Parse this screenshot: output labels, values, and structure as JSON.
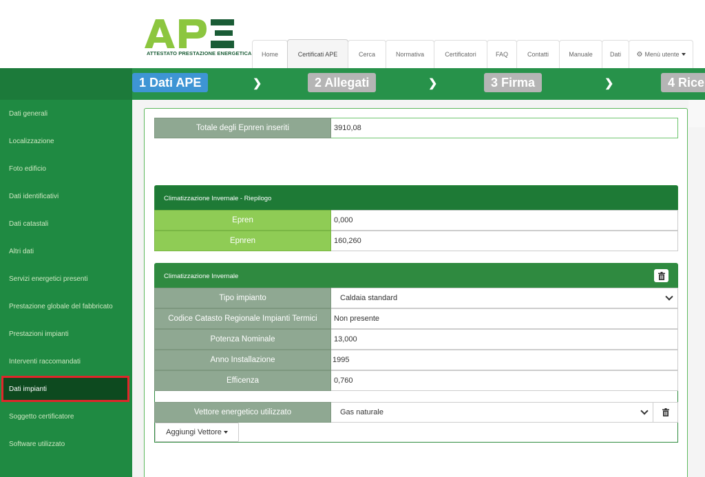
{
  "logo": {
    "name": "APE",
    "tagline": "ATTESTATO PRESTAZIONE ENERGETICA",
    "colors": {
      "green": "#8cc63f",
      "dark": "#1a5c36"
    }
  },
  "nav": {
    "tabs": [
      "Home",
      "Certificati APE",
      "Cerca",
      "Normativa",
      "Certificatori",
      "FAQ",
      "Contatti",
      "Manuale",
      "Dati",
      "Menù utente"
    ],
    "active_tab": "Certificati APE",
    "user_menu_icon": "gear-icon"
  },
  "steps": [
    {
      "label": "1 Dati APE",
      "active": true
    },
    {
      "label": "2 Allegati",
      "active": false
    },
    {
      "label": "3 Firma",
      "active": false
    },
    {
      "label": "4 Rice",
      "active": false
    }
  ],
  "sidebar": {
    "items": [
      "Dati generali",
      "Localizzazione",
      "Foto edificio",
      "Dati identificativi",
      "Dati catastali",
      "Altri dati",
      "Servizi energetici presenti",
      "Prestazione globale del fabbricato",
      "Prestazioni impianti",
      "Interventi raccomandati",
      "Dati impianti",
      "Soggetto certificatore",
      "Software utilizzato"
    ],
    "active_item": "Dati impianti"
  },
  "totale": {
    "label": "Totale degli Epnren inseriti",
    "value": "3910,08"
  },
  "riepilogo": {
    "title": "Climatizzazione Invernale - Riepilogo",
    "rows": [
      {
        "label": "Epren",
        "value": "0,000"
      },
      {
        "label": "Epnren",
        "value": "160,260"
      }
    ]
  },
  "invernale": {
    "title": "Climatizzazione Invernale",
    "rows": [
      {
        "label": "Tipo impianto",
        "value": "Caldaia standard"
      },
      {
        "label": "Codice Catasto Regionale Impianti Termici",
        "value": "Non presente"
      },
      {
        "label": "Potenza Nominale",
        "value": "13,000"
      },
      {
        "label": "Anno Installazione",
        "value": "1995"
      },
      {
        "label": "Efficenza",
        "value": "0,760"
      }
    ],
    "vettore": {
      "label": "Vettore energetico utilizzato",
      "value": "Gas naturale"
    },
    "add_button": "Aggiungi Vettore"
  }
}
